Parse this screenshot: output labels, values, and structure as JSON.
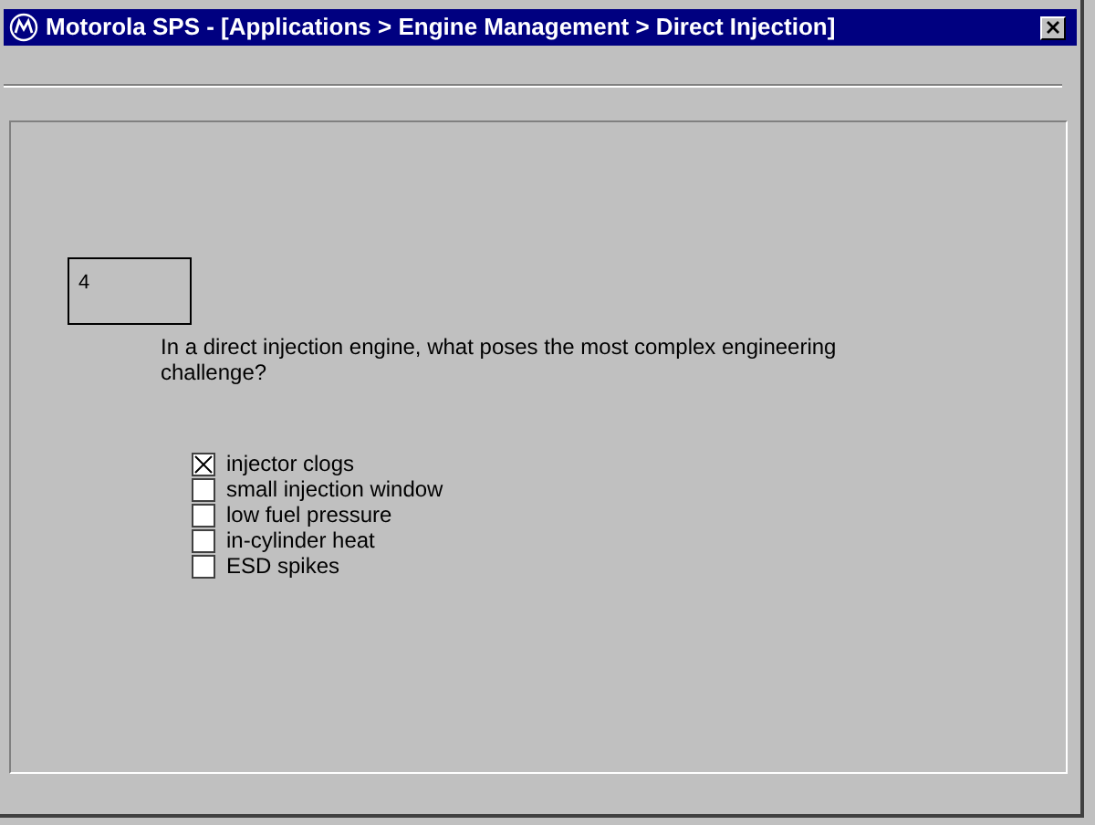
{
  "window": {
    "title": "Motorola SPS - [Applications > Engine Management > Direct Injection]"
  },
  "question": {
    "number": "4",
    "text": "In a direct injection engine, what poses the most complex engineering challenge?"
  },
  "options": [
    {
      "label": "injector clogs",
      "checked": true
    },
    {
      "label": "small injection window",
      "checked": false
    },
    {
      "label": "low fuel pressure",
      "checked": false
    },
    {
      "label": "in-cylinder heat",
      "checked": false
    },
    {
      "label": "ESD spikes",
      "checked": false
    }
  ]
}
